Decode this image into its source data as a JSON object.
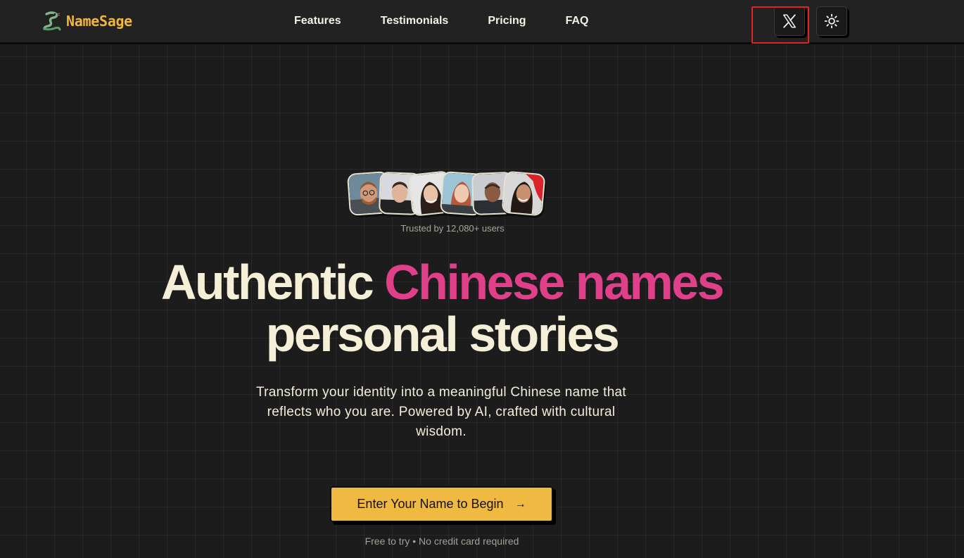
{
  "brand": {
    "name": "NameSage"
  },
  "nav": {
    "links": [
      {
        "label": "Features"
      },
      {
        "label": "Testimonials"
      },
      {
        "label": "Pricing"
      },
      {
        "label": "FAQ"
      }
    ]
  },
  "header_actions": {
    "x_icon": "x-logo-icon",
    "theme_icon": "sun-icon"
  },
  "hero": {
    "trusted_text": "Trusted by 12,080+ users",
    "headline_part1": "Authentic ",
    "headline_accent": "Chinese names",
    "headline_line2": "personal stories",
    "subtitle": "Transform your identity into a meaningful Chinese name that reflects who you are. Powered by AI, crafted with cultural wisdom.",
    "cta_label": "Enter Your Name to Begin",
    "cta_arrow": "→",
    "note": "Free to try • No credit card required"
  },
  "colors": {
    "background": "#1c1c1c",
    "accent_pink": "#e0408a",
    "accent_yellow": "#f0b942",
    "text_cream": "#f6efd8"
  }
}
